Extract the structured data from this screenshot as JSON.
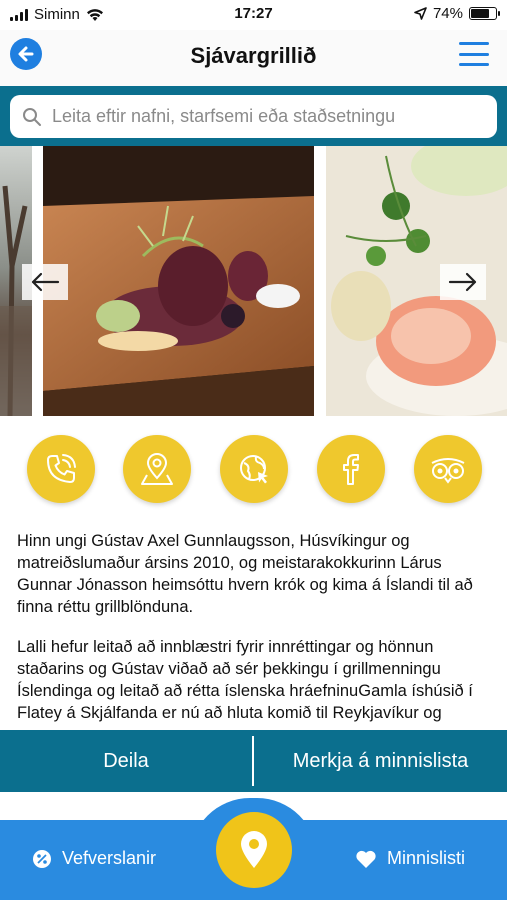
{
  "status_bar": {
    "carrier": "Siminn",
    "time": "17:27",
    "battery": "74%",
    "battery_level": 0.74
  },
  "header": {
    "title": "Sjávargrillið",
    "back_icon": "back-arrow-icon",
    "menu_icon": "hamburger-menu-icon"
  },
  "search": {
    "placeholder": "Leita eftir nafni, starfsemi eða staðsetningu"
  },
  "gallery": {
    "prev_icon": "arrow-left-icon",
    "next_icon": "arrow-right-icon"
  },
  "actions": [
    {
      "name": "phone",
      "icon": "phone-icon"
    },
    {
      "name": "map",
      "icon": "map-pin-icon"
    },
    {
      "name": "website",
      "icon": "globe-icon"
    },
    {
      "name": "facebook",
      "icon": "facebook-icon"
    },
    {
      "name": "tripadvisor",
      "icon": "tripadvisor-icon"
    }
  ],
  "description": {
    "paragraph1": "Hinn ungi Gústav Axel Gunnlaugsson, Húsvíkingur og matreiðslumaður ársins 2010, og meistarakokkurinn Lárus Gunnar Jónasson heimsóttu hvern krók og kima á Íslandi til að finna réttu grillblönduna.",
    "paragraph2": "Lalli hefur leitað að innblæstri fyrir innréttingar og hönnun staðarins og Gústav viðað að sér þekkingu í grillmenningu Íslendinga og leitað að rétta íslenska hráefninuGamla íshúsið í Flatey á Skjálfanda er nú að hluta komið til Reykjavíkur og"
  },
  "bottom_actions": {
    "share_label": "Deila",
    "bookmark_label": "Merkja á minnislista"
  },
  "tab_bar": {
    "left_label": "Vefverslanir",
    "right_label": "Minnislisti",
    "center_icon": "location-pin-icon"
  },
  "colors": {
    "accent_blue": "#1f7fe0",
    "teal": "#0b6f8e",
    "yellow": "#efc82d",
    "tab_blue": "#2a8be0"
  }
}
